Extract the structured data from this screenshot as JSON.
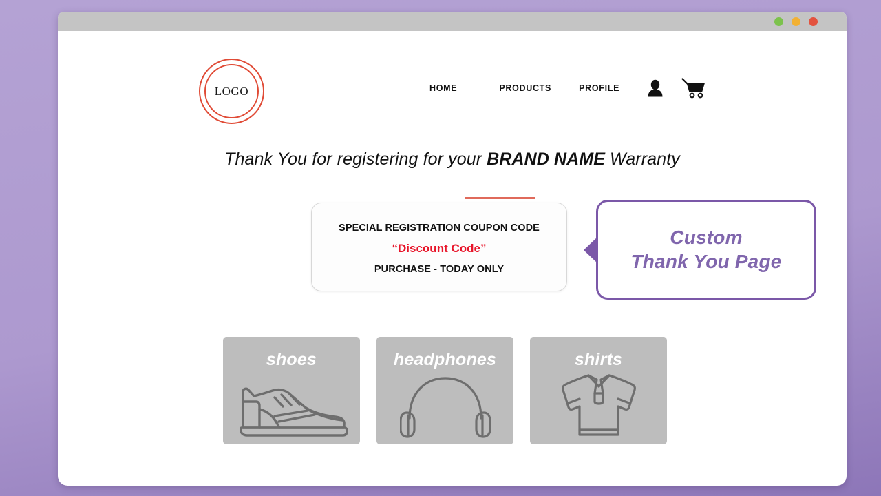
{
  "window": {
    "controls": [
      {
        "name": "minimize-dot",
        "color": "#7cc24c"
      },
      {
        "name": "maximize-dot",
        "color": "#f2b133"
      },
      {
        "name": "close-dot",
        "color": "#e3533f"
      }
    ]
  },
  "header": {
    "logo_text": "LOGO",
    "logo_color": "#e04b36",
    "nav": [
      {
        "label": "HOME",
        "name": "nav-home"
      },
      {
        "label": "PRODUCTS",
        "name": "nav-products"
      },
      {
        "label": "PROFILE",
        "name": "nav-profile"
      }
    ],
    "icons": [
      {
        "name": "user-icon"
      },
      {
        "name": "shopping-cart-icon"
      }
    ]
  },
  "main": {
    "headline_prefix": "Thank You for registering for your ",
    "headline_brand": "BRAND NAME",
    "headline_suffix": " Warranty",
    "rule_color": "#e06a5b"
  },
  "coupon": {
    "title": "SPECIAL REGISTRATION COUPON CODE",
    "code": "“Discount Code”",
    "code_color": "#e8152a",
    "subtitle": "PURCHASE - TODAY ONLY"
  },
  "callout": {
    "line1": "Custom",
    "line2": "Thank You Page",
    "color": "#8066ad",
    "border_color": "#7b58a8"
  },
  "cards": [
    {
      "label": "shoes",
      "icon": "shoe-icon"
    },
    {
      "label": "headphones",
      "icon": "headphones-icon"
    },
    {
      "label": "shirts",
      "icon": "polo-shirt-icon"
    }
  ],
  "theme": {
    "page_background": "#ae9bd0",
    "card_background": "#bdbdbd",
    "titlebar": "#c4c4c4"
  }
}
